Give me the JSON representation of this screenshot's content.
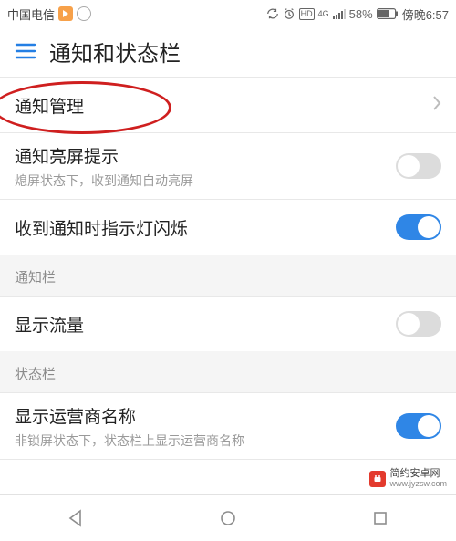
{
  "status_bar": {
    "carrier": "中国电信",
    "battery_pct": "58%",
    "time": "傍晚6:57",
    "net_label": "4G"
  },
  "header": {
    "title": "通知和状态栏"
  },
  "rows": {
    "notification_mgmt": {
      "label": "通知管理"
    },
    "wake_on_notify": {
      "label": "通知亮屏提示",
      "sub": "熄屏状态下，收到通知自动亮屏",
      "on": false
    },
    "led_blink": {
      "label": "收到通知时指示灯闪烁",
      "on": true
    },
    "show_traffic": {
      "label": "显示流量",
      "on": false
    },
    "show_carrier": {
      "label": "显示运营商名称",
      "sub": "非锁屏状态下，状态栏上显示运营商名称",
      "on": true
    }
  },
  "sections": {
    "notify_bar": "通知栏",
    "status_bar": "状态栏"
  },
  "watermark": {
    "cn": "简约安卓网",
    "url": "www.jyzsw.com"
  }
}
